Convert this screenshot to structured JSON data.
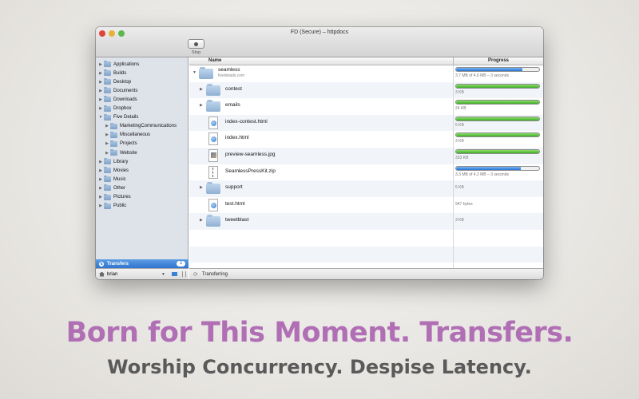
{
  "window": {
    "title": "FD (Secure) – httpdocs"
  },
  "toolbar": {
    "stop_label": "Stop"
  },
  "sidebar": {
    "items": [
      {
        "label": "Applications",
        "indent": 0,
        "expanded": false
      },
      {
        "label": "Builds",
        "indent": 0,
        "expanded": false
      },
      {
        "label": "Desktop",
        "indent": 0,
        "expanded": false
      },
      {
        "label": "Documents",
        "indent": 0,
        "expanded": false
      },
      {
        "label": "Downloads",
        "indent": 0,
        "expanded": false
      },
      {
        "label": "Dropbox",
        "indent": 0,
        "expanded": false
      },
      {
        "label": "Five Details",
        "indent": 0,
        "expanded": true
      },
      {
        "label": "MarketingCommunications",
        "indent": 1,
        "expanded": false
      },
      {
        "label": "Miscellaneous",
        "indent": 1,
        "expanded": false
      },
      {
        "label": "Projects",
        "indent": 1,
        "expanded": false
      },
      {
        "label": "Website",
        "indent": 1,
        "expanded": false
      },
      {
        "label": "Library",
        "indent": 0,
        "expanded": false
      },
      {
        "label": "Movies",
        "indent": 0,
        "expanded": false
      },
      {
        "label": "Music",
        "indent": 0,
        "expanded": false
      },
      {
        "label": "Other",
        "indent": 0,
        "expanded": false
      },
      {
        "label": "Pictures",
        "indent": 0,
        "expanded": false
      },
      {
        "label": "Public",
        "indent": 0,
        "expanded": false
      }
    ],
    "transfers_label": "Transfers",
    "transfers_count": "1",
    "user": "brian"
  },
  "columns": {
    "name": "Name",
    "progress": "Progress"
  },
  "files": [
    {
      "name": "seamless",
      "sub": "fivedetails.com",
      "kind": "folder",
      "level": 0,
      "tri": "▼",
      "progress": 0.8,
      "bar": "blue",
      "status": "3.7 MB of 4.6 MB – 3 seconds"
    },
    {
      "name": "contest",
      "kind": "folder",
      "level": 1,
      "tri": "▶",
      "progress": 1.0,
      "bar": "green",
      "status": "3 KB"
    },
    {
      "name": "emails",
      "kind": "folder",
      "level": 1,
      "tri": "▶",
      "progress": 1.0,
      "bar": "green",
      "status": "24 KB"
    },
    {
      "name": "index-contest.html",
      "kind": "html",
      "level": 1,
      "tri": "",
      "progress": 1.0,
      "bar": "green",
      "status": "5 KB"
    },
    {
      "name": "index.html",
      "kind": "html",
      "level": 1,
      "tri": "",
      "progress": 1.0,
      "bar": "green",
      "status": "3 KB"
    },
    {
      "name": "preview-seamless.jpg",
      "kind": "jpg",
      "level": 1,
      "tri": "",
      "progress": 1.0,
      "bar": "green",
      "status": "333 KB"
    },
    {
      "name": "SeamlessPressKit.zip",
      "kind": "zip",
      "level": 1,
      "tri": "",
      "progress": 0.78,
      "bar": "blue",
      "status": "3.3 MB of 4.2 MB – 3 seconds"
    },
    {
      "name": "support",
      "kind": "folder",
      "level": 1,
      "tri": "▶",
      "progress": null,
      "status": "5 KB"
    },
    {
      "name": "test.html",
      "kind": "html",
      "level": 1,
      "tri": "",
      "progress": null,
      "status": "947 bytes"
    },
    {
      "name": "tweetblast",
      "kind": "folder",
      "level": 1,
      "tri": "▶",
      "progress": null,
      "status": "3 KB"
    }
  ],
  "status_bar": {
    "text": "Transferring"
  },
  "marketing": {
    "headline": "Born for This Moment. Transfers.",
    "subline": "Worship Concurrency. Despise Latency."
  },
  "colors": {
    "headline": "#b06fb4",
    "subline": "#5a5a5a",
    "progress_green": "#3fae2a",
    "progress_blue": "#2874d8",
    "sidebar_selection": "#2f74cf"
  }
}
